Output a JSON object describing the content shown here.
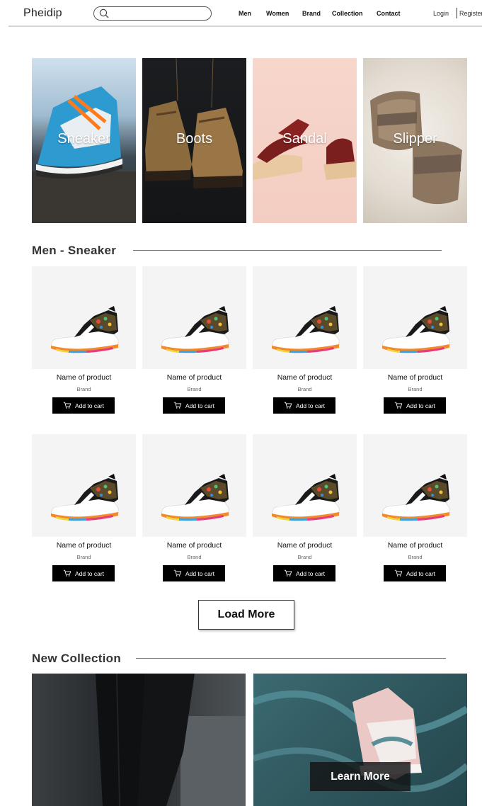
{
  "header": {
    "logo": "Pheidip",
    "search_placeholder": "",
    "nav": [
      "Men",
      "Women",
      "Brand",
      "Collection",
      "Contact"
    ],
    "login": "Login",
    "register": "Register"
  },
  "categories": [
    "Sneaker",
    "Boots",
    "Sandal",
    "Slipper"
  ],
  "sections": {
    "men_sneaker": "Men - Sneaker",
    "new_collection": "New Collection"
  },
  "products": [
    {
      "name": "Name of product",
      "brand": "Brand",
      "button": "Add to cart"
    },
    {
      "name": "Name of product",
      "brand": "Brand",
      "button": "Add to cart"
    },
    {
      "name": "Name of product",
      "brand": "Brand",
      "button": "Add to cart"
    },
    {
      "name": "Name of product",
      "brand": "Brand",
      "button": "Add to cart"
    },
    {
      "name": "Name of product",
      "brand": "Brand",
      "button": "Add to cart"
    },
    {
      "name": "Name of product",
      "brand": "Brand",
      "button": "Add to cart"
    },
    {
      "name": "Name of product",
      "brand": "Brand",
      "button": "Add to cart"
    },
    {
      "name": "Name of product",
      "brand": "Brand",
      "button": "Add to cart"
    }
  ],
  "load_more": "Load More",
  "learn_more": "Learn More",
  "icons": {
    "search": "search-icon",
    "cart": "cart-icon"
  }
}
